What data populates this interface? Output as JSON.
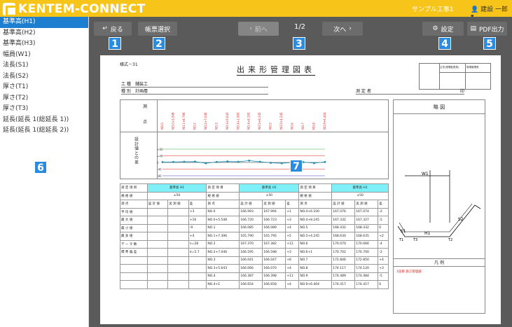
{
  "header": {
    "brand": "KENTEM-CONNECT",
    "project": "サンプル工事1",
    "user": "建設 一郎"
  },
  "sidebar": {
    "items": [
      "基準高(H1)",
      "基準高(H2)",
      "基準高(H3)",
      "幅員(W1)",
      "法長(S1)",
      "法長(S2)",
      "厚さ(T1)",
      "厚さ(T2)",
      "厚さ(T3)",
      "延長(延長 1(総延長 1))",
      "延長(延長 1(総延長 2))"
    ]
  },
  "toolbar": {
    "back": "戻る",
    "form_select": "帳票選択",
    "prev": "前へ",
    "page": "1/2",
    "next": "次へ",
    "settings": "設定",
    "pdf": "PDF出力"
  },
  "markers": [
    "1",
    "2",
    "3",
    "4",
    "5",
    "6",
    "7"
  ],
  "doc": {
    "form_no": "様式－31",
    "title": "出来形管理図表",
    "koshu_label": "工 種",
    "koshu": "舗装工",
    "shubetsu_label": "種 別",
    "shubetsu": "計画層",
    "sokuteisha": "測 定 者",
    "in": "印",
    "stamp1": "主任(現場監督員)",
    "stamp2": "現場管理員",
    "sokuten1": "測",
    "sokuten2": "点",
    "graph_label": "設計値との差",
    "ryakuzu": "略 図",
    "hanrei": "凡 例",
    "hanrei_item": "1段目 施工管理値",
    "points": [
      "NO.0",
      "NO.0+5.548",
      "NO.1+8.796",
      "NO.2",
      "NO.2+7.046",
      "NO.3",
      "NO.3+5.643",
      "NO.4+1.000",
      "NO.4+6.100",
      "NO.5+8.245",
      "NO.5",
      "NO.5+4.245",
      "NO.6",
      "NO.7",
      "NO.8",
      "NO.9+6.404"
    ],
    "labels": {
      "h1": "基準高 H1",
      "std": "±50",
      "unit": "mm",
      "kijun": "規 格 値",
      "item": "測 定 項 目",
      "sokuten": "測 点",
      "avg": "平 均 値",
      "max": "最 大 値",
      "min": "最 小 値",
      "n": "最 多 値",
      "data": "デ ー タ 数",
      "sd": "標 準 偏 差",
      "sekkei": "設 計 値",
      "jisseki": "実 測 値",
      "sa": "差"
    },
    "stats": [
      "+3",
      "+16",
      "-9",
      "+4",
      "n=28",
      "σ=5.7"
    ],
    "col1": [
      [
        "NO.0",
        "166.993",
        "167.994",
        "+1"
      ],
      [
        "NO.0+5.548",
        "166.720",
        "166.723",
        "+3"
      ],
      [
        "NO.1",
        "166.085",
        "166.089",
        "+4"
      ],
      [
        "NO.1+7.396",
        "165.790",
        "165.795",
        "+5"
      ],
      [
        "NO.2",
        "167.370",
        "167.382",
        "+12"
      ],
      [
        "NO.2+7.046",
        "166.595",
        "166.598",
        "+3"
      ],
      [
        "NO.3",
        "166.041",
        "166.047",
        "+6"
      ],
      [
        "NO.3+5.643",
        "166.066",
        "166.070",
        "+4"
      ],
      [
        "NO.4",
        "166.387",
        "166.398",
        "+11"
      ],
      [
        "NO.4+1",
        "166.654",
        "166.658",
        "+4"
      ]
    ],
    "col2": [
      [
        "NO.4+6.100",
        "167.076",
        "167.074",
        "-2"
      ],
      [
        "NO.4+8.245",
        "167.332",
        "167.327",
        "-5"
      ],
      [
        "NO.5",
        "168.432",
        "168.432",
        "0"
      ],
      [
        "NO.5+4.245",
        "168.630",
        "168.635",
        "+2"
      ],
      [
        "NO.6",
        "170.070",
        "170.066",
        "-4"
      ],
      [
        "NO.6+1",
        "170.702",
        "170.700",
        "-2"
      ],
      [
        "NO.7",
        "172.846",
        "172.850",
        "+4"
      ],
      [
        "NO.8",
        "174.117",
        "174.120",
        "+3"
      ],
      [
        "NO.9",
        "174.489",
        "174.484",
        "-5"
      ],
      [
        "NO.9+6.404",
        "174.417",
        "174.417",
        "0"
      ]
    ],
    "ryakuzu_labels": [
      "W1",
      "S2",
      "S1",
      "H1",
      "T1",
      "T2",
      "T3"
    ]
  },
  "chart_data": {
    "type": "line",
    "categories": [
      "NO.0",
      "NO.0+5.548",
      "NO.1+8.796",
      "NO.2",
      "NO.2+7.046",
      "NO.3",
      "NO.3+5.643",
      "NO.4+1.000",
      "NO.4+6.100",
      "NO.5+8.245",
      "NO.5",
      "NO.5+4.245",
      "NO.6",
      "NO.7",
      "NO.8",
      "NO.9+6.404"
    ],
    "series": [
      {
        "values": [
          2,
          3,
          4,
          5,
          -5,
          3,
          6,
          4,
          11,
          4,
          -2,
          -5,
          0,
          2,
          -4,
          3
        ]
      }
    ],
    "ylim": [
      -80,
      80
    ],
    "yticks": [
      "+80",
      "+40",
      "0",
      "-40",
      "-80"
    ]
  },
  "colors": {
    "accent": "#f7c41a",
    "badge": "#2b8be0",
    "active": "#1e7fd1",
    "cyan": "#7ff0f7"
  }
}
